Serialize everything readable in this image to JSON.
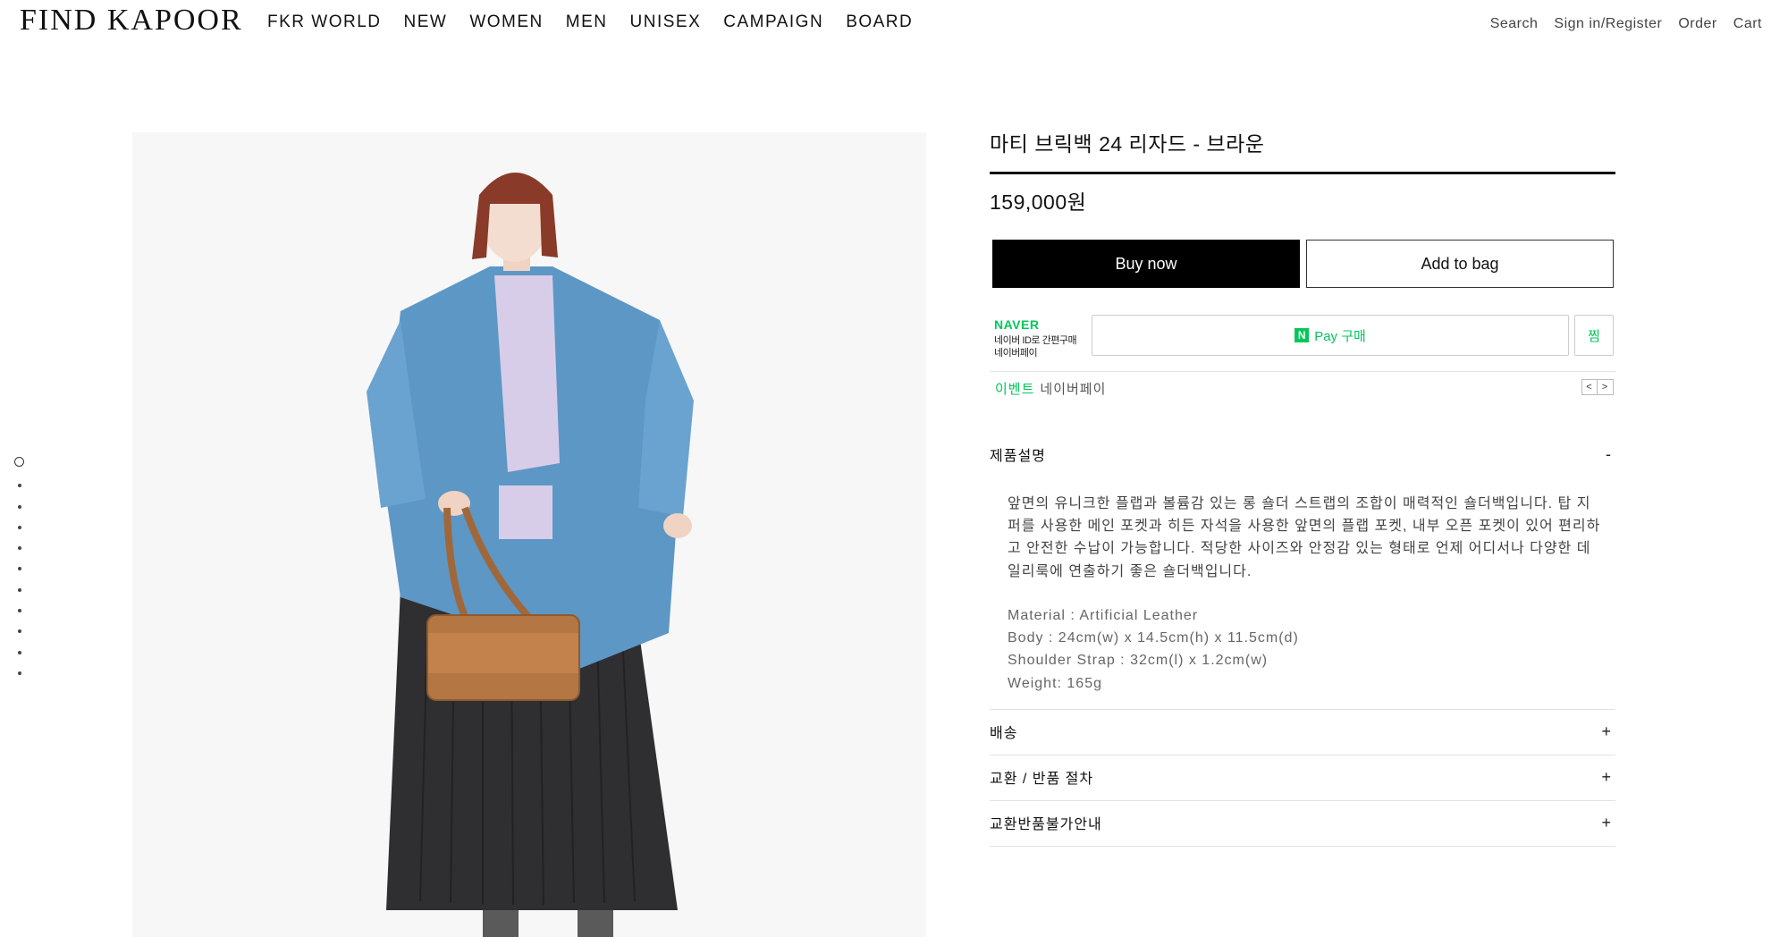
{
  "header": {
    "logo": "FIND KAPOOR",
    "nav": [
      "FKR WORLD",
      "NEW",
      "WOMEN",
      "MEN",
      "UNISEX",
      "CAMPAIGN",
      "BOARD"
    ],
    "utils": [
      "Search",
      "Sign in/Register",
      "Order",
      "Cart"
    ]
  },
  "gallery": {
    "slide_count": 11,
    "active_index": 0
  },
  "product": {
    "title": "마티 브릭백 24 리자드 - 브라운",
    "price": "159,000원",
    "buy_label": "Buy now",
    "bag_label": "Add to bag"
  },
  "naver": {
    "logo": "NAVER",
    "sub1": "네이버 ID로 간편구매",
    "sub2": "네이버페이",
    "npay_mark": "N",
    "npay_label": "Pay 구매",
    "zzim_label": "찜",
    "event_label": "이벤트",
    "event_text": "네이버페이",
    "prev": "<",
    "next": ">"
  },
  "accordion": {
    "description": {
      "label": "제품설명",
      "symbol": "-",
      "text": "앞면의 유니크한 플랩과 볼륨감 있는 롱 숄더 스트랩의 조합이 매력적인 숄더백입니다. 탑 지퍼를 사용한 메인 포켓과 히든 자석을 사용한 앞면의 플랩 포켓, 내부 오픈 포켓이 있어 편리하고 안전한 수납이 가능합니다. 적당한 사이즈와 안정감 있는 형태로 언제 어디서나 다양한 데일리룩에 연출하기 좋은 숄더백입니다.",
      "specs": [
        "Material : Artificial Leather",
        "Body : 24cm(w) x 14.5cm(h) x 11.5cm(d)",
        "Shoulder Strap : 32cm(l) x 1.2cm(w)",
        "Weight: 165g"
      ]
    },
    "shipping": {
      "label": "배송",
      "symbol": "+"
    },
    "exchange": {
      "label": "교환 / 반품 절차",
      "symbol": "+"
    },
    "no_exchange": {
      "label": "교환반품불가안내",
      "symbol": "+"
    }
  }
}
